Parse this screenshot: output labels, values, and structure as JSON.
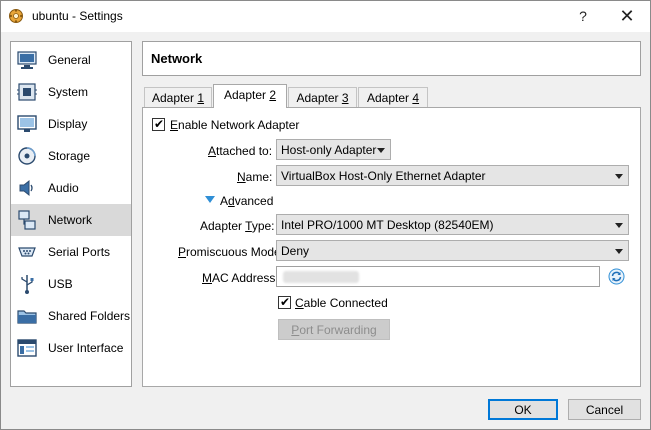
{
  "window": {
    "title": "ubuntu - Settings",
    "help_glyph": "?",
    "close_glyph": "✕",
    "app_icon": "virtualbox-gear-icon"
  },
  "sidebar": {
    "items": [
      {
        "label": "General",
        "icon": "general-icon"
      },
      {
        "label": "System",
        "icon": "system-icon"
      },
      {
        "label": "Display",
        "icon": "display-icon"
      },
      {
        "label": "Storage",
        "icon": "storage-icon"
      },
      {
        "label": "Audio",
        "icon": "audio-icon"
      },
      {
        "label": "Network",
        "icon": "network-icon",
        "selected": true
      },
      {
        "label": "Serial Ports",
        "icon": "serial-ports-icon"
      },
      {
        "label": "USB",
        "icon": "usb-icon"
      },
      {
        "label": "Shared Folders",
        "icon": "shared-folders-icon"
      },
      {
        "label": "User Interface",
        "icon": "user-interface-icon"
      }
    ]
  },
  "page": {
    "title": "Network"
  },
  "tabs": [
    {
      "label_pre": "Adapter ",
      "label_key": "1",
      "active": false
    },
    {
      "label_pre": "Adapter ",
      "label_key": "2",
      "active": true
    },
    {
      "label_pre": "Adapter ",
      "label_key": "3",
      "active": false
    },
    {
      "label_pre": "Adapter ",
      "label_key": "4",
      "active": false
    }
  ],
  "adapter": {
    "enable_label_key": "E",
    "enable_label_rest": "nable Network Adapter",
    "enable_checked": true,
    "attached_label_pre": "",
    "attached_label_key": "A",
    "attached_label_rest": "ttached to:",
    "attached_value": "Host-only Adapter",
    "name_label_key": "N",
    "name_label_rest": "ame:",
    "name_value": "VirtualBox Host-Only Ethernet Adapter",
    "advanced_label_pre": "A",
    "advanced_label_key": "d",
    "advanced_label_rest": "vanced",
    "adapter_type_label_pre": "Adapter ",
    "adapter_type_label_key": "T",
    "adapter_type_label_rest": "ype:",
    "adapter_type_value": "Intel PRO/1000 MT Desktop (82540EM)",
    "promiscuous_label_key": "P",
    "promiscuous_label_rest": "romiscuous Mode:",
    "promiscuous_value": "Deny",
    "mac_label_pre": "",
    "mac_label_key": "M",
    "mac_label_rest": "AC Address:",
    "cable_label_key": "C",
    "cable_label_rest": "able Connected",
    "cable_checked": true,
    "port_forwarding_key": "P",
    "port_forwarding_rest": "ort Forwarding"
  },
  "footer": {
    "ok_label": "OK",
    "cancel_label": "Cancel"
  },
  "colors": {
    "accent": "#0078d7",
    "selected_bg": "#d9d9d9",
    "advanced_arrow": "#2f8fd6"
  }
}
